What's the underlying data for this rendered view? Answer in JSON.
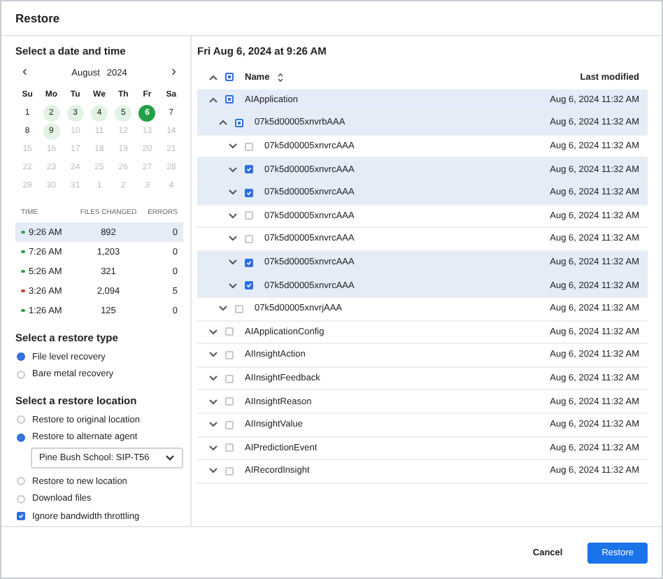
{
  "window": {
    "title": "Restore"
  },
  "date_panel": {
    "heading": "Select a date and time",
    "prev": "‹",
    "next": "›",
    "month": "August",
    "year": "2024",
    "weekdays": [
      "Su",
      "Mo",
      "Tu",
      "We",
      "Th",
      "Fr",
      "Sa"
    ],
    "days": [
      {
        "label": "1",
        "backup": false,
        "selected": false,
        "disabled": false
      },
      {
        "label": "2",
        "backup": true,
        "selected": false,
        "disabled": false
      },
      {
        "label": "3",
        "backup": true,
        "selected": false,
        "disabled": false
      },
      {
        "label": "4",
        "backup": true,
        "selected": false,
        "disabled": false
      },
      {
        "label": "5",
        "backup": true,
        "selected": false,
        "disabled": false
      },
      {
        "label": "6",
        "backup": true,
        "selected": true,
        "disabled": false
      },
      {
        "label": "7",
        "backup": false,
        "selected": false,
        "disabled": false
      },
      {
        "label": "8",
        "backup": false,
        "selected": false,
        "disabled": false
      },
      {
        "label": "9",
        "backup": true,
        "selected": false,
        "disabled": false
      },
      {
        "label": "10",
        "backup": false,
        "selected": false,
        "disabled": true
      },
      {
        "label": "11",
        "backup": false,
        "selected": false,
        "disabled": true
      },
      {
        "label": "12",
        "backup": false,
        "selected": false,
        "disabled": true
      },
      {
        "label": "13",
        "backup": false,
        "selected": false,
        "disabled": true
      },
      {
        "label": "14",
        "backup": false,
        "selected": false,
        "disabled": true
      },
      {
        "label": "15",
        "backup": false,
        "selected": false,
        "disabled": true
      },
      {
        "label": "16",
        "backup": false,
        "selected": false,
        "disabled": true
      },
      {
        "label": "17",
        "backup": false,
        "selected": false,
        "disabled": true
      },
      {
        "label": "18",
        "backup": false,
        "selected": false,
        "disabled": true
      },
      {
        "label": "19",
        "backup": false,
        "selected": false,
        "disabled": true
      },
      {
        "label": "20",
        "backup": false,
        "selected": false,
        "disabled": true
      },
      {
        "label": "21",
        "backup": false,
        "selected": false,
        "disabled": true
      },
      {
        "label": "22",
        "backup": false,
        "selected": false,
        "disabled": true
      },
      {
        "label": "23",
        "backup": false,
        "selected": false,
        "disabled": true
      },
      {
        "label": "24",
        "backup": false,
        "selected": false,
        "disabled": true
      },
      {
        "label": "25",
        "backup": false,
        "selected": false,
        "disabled": true
      },
      {
        "label": "26",
        "backup": false,
        "selected": false,
        "disabled": true
      },
      {
        "label": "27",
        "backup": false,
        "selected": false,
        "disabled": true
      },
      {
        "label": "28",
        "backup": false,
        "selected": false,
        "disabled": true
      },
      {
        "label": "29",
        "backup": false,
        "selected": false,
        "disabled": true
      },
      {
        "label": "30",
        "backup": false,
        "selected": false,
        "disabled": true
      },
      {
        "label": "31",
        "backup": false,
        "selected": false,
        "disabled": true
      },
      {
        "label": "1",
        "backup": false,
        "selected": false,
        "disabled": true
      },
      {
        "label": "2",
        "backup": false,
        "selected": false,
        "disabled": true
      },
      {
        "label": "3",
        "backup": false,
        "selected": false,
        "disabled": true
      },
      {
        "label": "4",
        "backup": false,
        "selected": false,
        "disabled": true
      }
    ],
    "backups": {
      "columns": [
        "TIME",
        "FILES CHANGED",
        "ERRORS"
      ],
      "rows": [
        {
          "time": "9:26 AM",
          "files": "892",
          "errors": "0",
          "color": "#2e9e4f",
          "selected": true
        },
        {
          "time": "7:26 AM",
          "files": "1,203",
          "errors": "0",
          "color": "#2e9e4f",
          "selected": false
        },
        {
          "time": "5:26 AM",
          "files": "321",
          "errors": "0",
          "color": "#2e9e4f",
          "selected": false
        },
        {
          "time": "3:26 AM",
          "files": "2,094",
          "errors": "5",
          "color": "#d9342b",
          "selected": false
        },
        {
          "time": "1:26 AM",
          "files": "125",
          "errors": "0",
          "color": "#2e9e4f",
          "selected": false
        }
      ]
    },
    "restore_type": {
      "heading": "Select a restore type",
      "options": [
        {
          "label": "File level recovery",
          "selected": true
        },
        {
          "label": "Bare metal recovery",
          "selected": false
        }
      ]
    },
    "restore_location": {
      "heading": "Select a restore location",
      "options": [
        {
          "kind": "radio",
          "label": "Restore to original location",
          "selected": false
        },
        {
          "kind": "radio",
          "label": "Restore to alternate agent",
          "selected": true
        },
        {
          "kind": "dropdown",
          "value": "Pine Bush School: SIP-T56"
        },
        {
          "kind": "radio",
          "label": "Restore to new location",
          "selected": false
        },
        {
          "kind": "radio",
          "label": "Download files",
          "selected": false
        }
      ]
    },
    "throttling": {
      "label": "Ignore bandwidth throttling",
      "checked": true
    }
  },
  "files": {
    "heading": "Fri Aug 6, 2024 at 9:26 AM",
    "columns": {
      "name": "Name",
      "modified": "Last modified"
    },
    "all_partial": true,
    "rows": [
      {
        "name": "AIApplication",
        "modified": "Aug 6, 2024 11:32 AM",
        "expanded": true,
        "checked": false,
        "partial": true,
        "children": [
          {
            "name": "07k5d00005xnvrbAAA",
            "modified": "Aug 6, 2024 11:32 AM",
            "expanded": true,
            "checked": false,
            "partial": true,
            "children": [
              {
                "name": "07k5d00005xnvrcAAA",
                "modified": "Aug 6, 2024 11:32 AM",
                "expanded": false,
                "checked": false,
                "partial": false
              },
              {
                "name": "07k5d00005xnvrcAAA",
                "modified": "Aug 6, 2024 11:32 AM",
                "expanded": false,
                "checked": true,
                "partial": false
              },
              {
                "name": "07k5d00005xnvrcAAA",
                "modified": "Aug 6, 2024 11:32 AM",
                "expanded": false,
                "checked": true,
                "partial": false
              },
              {
                "name": "07k5d00005xnvrcAAA",
                "modified": "Aug 6, 2024 11:32 AM",
                "expanded": false,
                "checked": false,
                "partial": false
              },
              {
                "name": "07k5d00005xnvrcAAA",
                "modified": "Aug 6, 2024 11:32 AM",
                "expanded": false,
                "checked": false,
                "partial": false
              },
              {
                "name": "07k5d00005xnvrcAAA",
                "modified": "Aug 6, 2024 11:32 AM",
                "expanded": false,
                "checked": true,
                "partial": false
              },
              {
                "name": "07k5d00005xnvrcAAA",
                "modified": "Aug 6, 2024 11:32 AM",
                "expanded": false,
                "checked": true,
                "partial": false
              }
            ]
          },
          {
            "name": "07k5d00005xnvrjAAA",
            "modified": "Aug 6, 2024 11:32 AM",
            "expanded": false,
            "checked": false,
            "partial": false
          }
        ]
      },
      {
        "name": "AIApplicationConfig",
        "modified": "Aug 6, 2024 11:32 AM",
        "expanded": false,
        "checked": false,
        "partial": false
      },
      {
        "name": "AIInsightAction",
        "modified": "Aug 6, 2024 11:32 AM",
        "expanded": false,
        "checked": false,
        "partial": false
      },
      {
        "name": "AIInsightFeedback",
        "modified": "Aug 6, 2024 11:32 AM",
        "expanded": false,
        "checked": false,
        "partial": false
      },
      {
        "name": "AIInsightReason",
        "modified": "Aug 6, 2024 11:32 AM",
        "expanded": false,
        "checked": false,
        "partial": false
      },
      {
        "name": "AIInsightValue",
        "modified": "Aug 6, 2024 11:32 AM",
        "expanded": false,
        "checked": false,
        "partial": false
      },
      {
        "name": "AIPredictionEvent",
        "modified": "Aug 6, 2024 11:32 AM",
        "expanded": false,
        "checked": false,
        "partial": false
      },
      {
        "name": "AIRecordInsight",
        "modified": "Aug 6, 2024 11:32 AM",
        "expanded": false,
        "checked": false,
        "partial": false
      }
    ]
  },
  "buttons": {
    "cancel": "Cancel",
    "restore": "Restore"
  }
}
